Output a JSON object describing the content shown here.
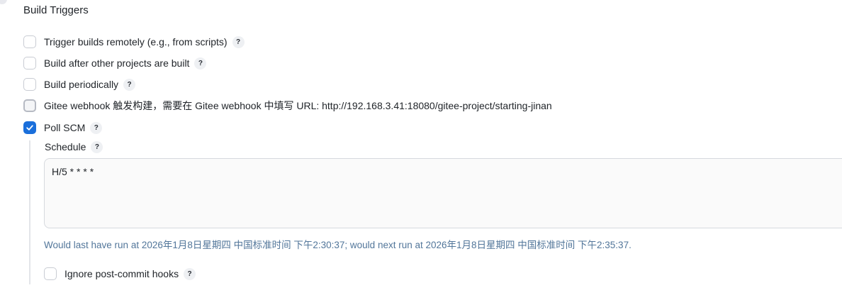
{
  "section": {
    "title": "Build Triggers"
  },
  "triggers": [
    {
      "label": "Trigger builds remotely (e.g., from scripts)",
      "checked": false,
      "help": "?"
    },
    {
      "label": "Build after other projects are built",
      "checked": false,
      "help": "?"
    },
    {
      "label": "Build periodically",
      "checked": false,
      "help": "?"
    },
    {
      "label": "Gitee webhook 触发构建，需要在 Gitee webhook 中填写 URL: http://192.168.3.41:18080/gitee-project/starting-jinan",
      "checked": false
    },
    {
      "label": "Poll SCM",
      "checked": true,
      "help": "?"
    }
  ],
  "poll_scm": {
    "schedule_label": "Schedule",
    "schedule_help": "?",
    "schedule_value": "H/5 * * * *",
    "run_info": "Would last have run at 2026年1月8日星期四 中国标准时间 下午2:30:37; would next run at 2026年1月8日星期四 中国标准时间 下午2:35:37.",
    "ignore_hooks_label": "Ignore post-commit hooks",
    "ignore_hooks_help": "?",
    "ignore_hooks_checked": false
  },
  "colors": {
    "accent": "#1a6fdb",
    "run_info_text": "#52769a"
  }
}
